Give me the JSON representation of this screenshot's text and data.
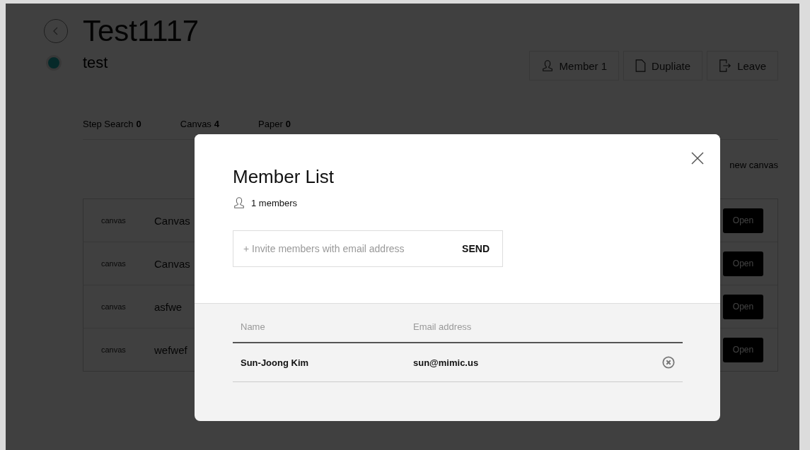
{
  "page": {
    "title": "Test1117",
    "subtitle": "test"
  },
  "header_buttons": [
    {
      "kind": "member",
      "label": "Member 1"
    },
    {
      "kind": "duplicate",
      "label": "Dupliate"
    },
    {
      "kind": "leave",
      "label": "Leave"
    }
  ],
  "stats": [
    {
      "label": "Step Search",
      "value": "0"
    },
    {
      "label": "Canvas",
      "value": "4"
    },
    {
      "label": "Paper",
      "value": "0"
    }
  ],
  "new_canvas_link": "new canvas",
  "canvases": [
    {
      "type": "canvas",
      "name": "Canvas",
      "action": "Open"
    },
    {
      "type": "canvas",
      "name": "Canvas",
      "action": "Open"
    },
    {
      "type": "canvas",
      "name": "asfwe",
      "action": "Open"
    },
    {
      "type": "canvas",
      "name": "wefwef",
      "action": "Open"
    }
  ],
  "modal": {
    "title": "Member List",
    "member_count": "1 members",
    "invite": {
      "placeholder": "+ Invite members with email address",
      "button": "SEND"
    },
    "table": {
      "columns": [
        "Name",
        "Email address"
      ],
      "rows": [
        {
          "name": "Sun-Joong Kim",
          "email": "sun@mimic.us"
        }
      ]
    }
  }
}
